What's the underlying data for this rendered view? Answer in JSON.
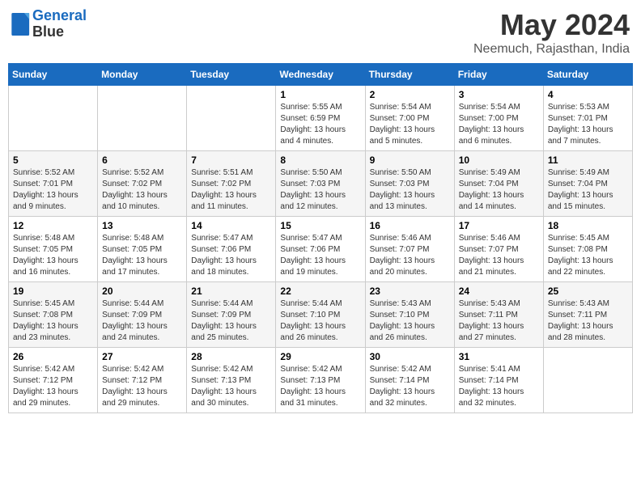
{
  "header": {
    "logo_line1": "General",
    "logo_line2": "Blue",
    "month": "May 2024",
    "location": "Neemuch, Rajasthan, India"
  },
  "days_of_week": [
    "Sunday",
    "Monday",
    "Tuesday",
    "Wednesday",
    "Thursday",
    "Friday",
    "Saturday"
  ],
  "weeks": [
    [
      {
        "day": "",
        "sunrise": "",
        "sunset": "",
        "daylight": ""
      },
      {
        "day": "",
        "sunrise": "",
        "sunset": "",
        "daylight": ""
      },
      {
        "day": "",
        "sunrise": "",
        "sunset": "",
        "daylight": ""
      },
      {
        "day": "1",
        "sunrise": "Sunrise: 5:55 AM",
        "sunset": "Sunset: 6:59 PM",
        "daylight": "Daylight: 13 hours and 4 minutes."
      },
      {
        "day": "2",
        "sunrise": "Sunrise: 5:54 AM",
        "sunset": "Sunset: 7:00 PM",
        "daylight": "Daylight: 13 hours and 5 minutes."
      },
      {
        "day": "3",
        "sunrise": "Sunrise: 5:54 AM",
        "sunset": "Sunset: 7:00 PM",
        "daylight": "Daylight: 13 hours and 6 minutes."
      },
      {
        "day": "4",
        "sunrise": "Sunrise: 5:53 AM",
        "sunset": "Sunset: 7:01 PM",
        "daylight": "Daylight: 13 hours and 7 minutes."
      }
    ],
    [
      {
        "day": "5",
        "sunrise": "Sunrise: 5:52 AM",
        "sunset": "Sunset: 7:01 PM",
        "daylight": "Daylight: 13 hours and 9 minutes."
      },
      {
        "day": "6",
        "sunrise": "Sunrise: 5:52 AM",
        "sunset": "Sunset: 7:02 PM",
        "daylight": "Daylight: 13 hours and 10 minutes."
      },
      {
        "day": "7",
        "sunrise": "Sunrise: 5:51 AM",
        "sunset": "Sunset: 7:02 PM",
        "daylight": "Daylight: 13 hours and 11 minutes."
      },
      {
        "day": "8",
        "sunrise": "Sunrise: 5:50 AM",
        "sunset": "Sunset: 7:03 PM",
        "daylight": "Daylight: 13 hours and 12 minutes."
      },
      {
        "day": "9",
        "sunrise": "Sunrise: 5:50 AM",
        "sunset": "Sunset: 7:03 PM",
        "daylight": "Daylight: 13 hours and 13 minutes."
      },
      {
        "day": "10",
        "sunrise": "Sunrise: 5:49 AM",
        "sunset": "Sunset: 7:04 PM",
        "daylight": "Daylight: 13 hours and 14 minutes."
      },
      {
        "day": "11",
        "sunrise": "Sunrise: 5:49 AM",
        "sunset": "Sunset: 7:04 PM",
        "daylight": "Daylight: 13 hours and 15 minutes."
      }
    ],
    [
      {
        "day": "12",
        "sunrise": "Sunrise: 5:48 AM",
        "sunset": "Sunset: 7:05 PM",
        "daylight": "Daylight: 13 hours and 16 minutes."
      },
      {
        "day": "13",
        "sunrise": "Sunrise: 5:48 AM",
        "sunset": "Sunset: 7:05 PM",
        "daylight": "Daylight: 13 hours and 17 minutes."
      },
      {
        "day": "14",
        "sunrise": "Sunrise: 5:47 AM",
        "sunset": "Sunset: 7:06 PM",
        "daylight": "Daylight: 13 hours and 18 minutes."
      },
      {
        "day": "15",
        "sunrise": "Sunrise: 5:47 AM",
        "sunset": "Sunset: 7:06 PM",
        "daylight": "Daylight: 13 hours and 19 minutes."
      },
      {
        "day": "16",
        "sunrise": "Sunrise: 5:46 AM",
        "sunset": "Sunset: 7:07 PM",
        "daylight": "Daylight: 13 hours and 20 minutes."
      },
      {
        "day": "17",
        "sunrise": "Sunrise: 5:46 AM",
        "sunset": "Sunset: 7:07 PM",
        "daylight": "Daylight: 13 hours and 21 minutes."
      },
      {
        "day": "18",
        "sunrise": "Sunrise: 5:45 AM",
        "sunset": "Sunset: 7:08 PM",
        "daylight": "Daylight: 13 hours and 22 minutes."
      }
    ],
    [
      {
        "day": "19",
        "sunrise": "Sunrise: 5:45 AM",
        "sunset": "Sunset: 7:08 PM",
        "daylight": "Daylight: 13 hours and 23 minutes."
      },
      {
        "day": "20",
        "sunrise": "Sunrise: 5:44 AM",
        "sunset": "Sunset: 7:09 PM",
        "daylight": "Daylight: 13 hours and 24 minutes."
      },
      {
        "day": "21",
        "sunrise": "Sunrise: 5:44 AM",
        "sunset": "Sunset: 7:09 PM",
        "daylight": "Daylight: 13 hours and 25 minutes."
      },
      {
        "day": "22",
        "sunrise": "Sunrise: 5:44 AM",
        "sunset": "Sunset: 7:10 PM",
        "daylight": "Daylight: 13 hours and 26 minutes."
      },
      {
        "day": "23",
        "sunrise": "Sunrise: 5:43 AM",
        "sunset": "Sunset: 7:10 PM",
        "daylight": "Daylight: 13 hours and 26 minutes."
      },
      {
        "day": "24",
        "sunrise": "Sunrise: 5:43 AM",
        "sunset": "Sunset: 7:11 PM",
        "daylight": "Daylight: 13 hours and 27 minutes."
      },
      {
        "day": "25",
        "sunrise": "Sunrise: 5:43 AM",
        "sunset": "Sunset: 7:11 PM",
        "daylight": "Daylight: 13 hours and 28 minutes."
      }
    ],
    [
      {
        "day": "26",
        "sunrise": "Sunrise: 5:42 AM",
        "sunset": "Sunset: 7:12 PM",
        "daylight": "Daylight: 13 hours and 29 minutes."
      },
      {
        "day": "27",
        "sunrise": "Sunrise: 5:42 AM",
        "sunset": "Sunset: 7:12 PM",
        "daylight": "Daylight: 13 hours and 29 minutes."
      },
      {
        "day": "28",
        "sunrise": "Sunrise: 5:42 AM",
        "sunset": "Sunset: 7:13 PM",
        "daylight": "Daylight: 13 hours and 30 minutes."
      },
      {
        "day": "29",
        "sunrise": "Sunrise: 5:42 AM",
        "sunset": "Sunset: 7:13 PM",
        "daylight": "Daylight: 13 hours and 31 minutes."
      },
      {
        "day": "30",
        "sunrise": "Sunrise: 5:42 AM",
        "sunset": "Sunset: 7:14 PM",
        "daylight": "Daylight: 13 hours and 32 minutes."
      },
      {
        "day": "31",
        "sunrise": "Sunrise: 5:41 AM",
        "sunset": "Sunset: 7:14 PM",
        "daylight": "Daylight: 13 hours and 32 minutes."
      },
      {
        "day": "",
        "sunrise": "",
        "sunset": "",
        "daylight": ""
      }
    ]
  ]
}
